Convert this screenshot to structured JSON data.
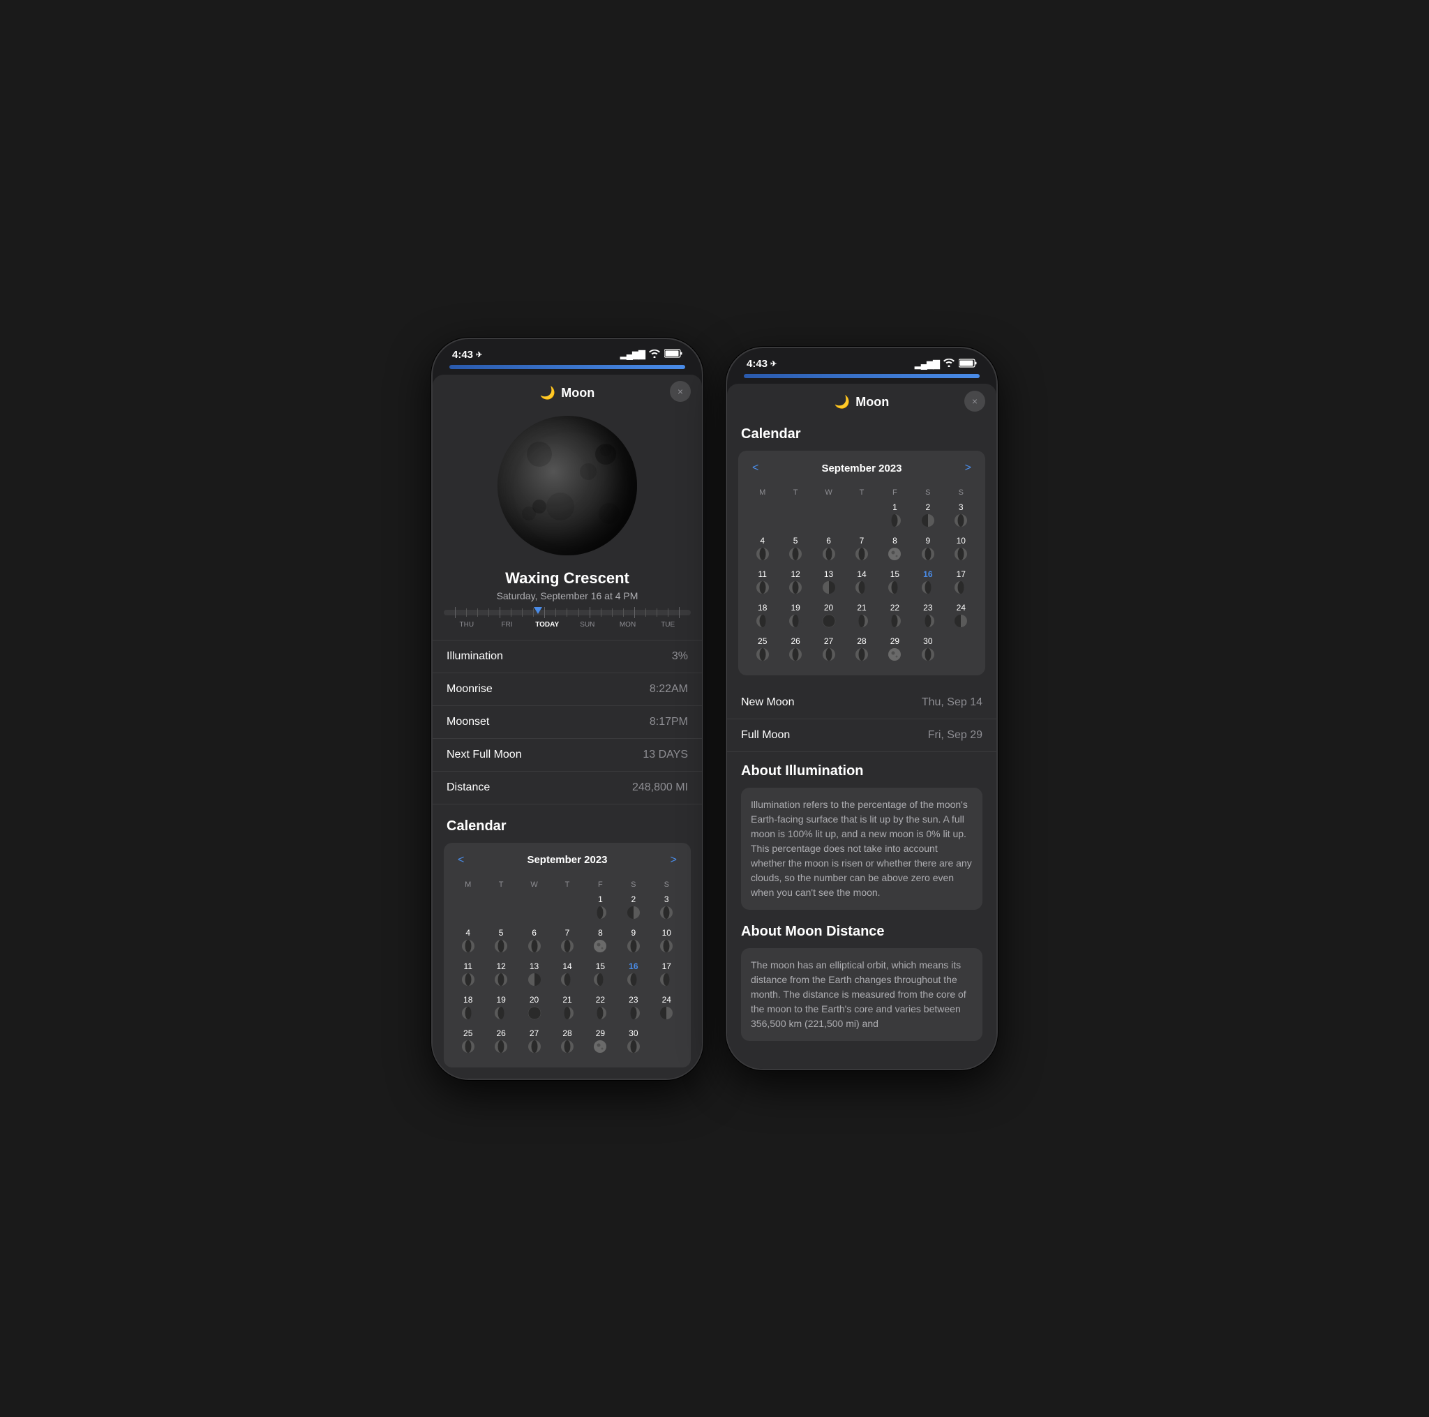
{
  "phone_left": {
    "status": {
      "time": "4:43",
      "location_icon": "▶",
      "signal_bars": "▐▌▌▌",
      "wifi": "wifi",
      "battery": "battery"
    },
    "app_title": "Moon",
    "close_label": "×",
    "moon_phase": "Waxing Crescent",
    "moon_date": "Saturday, September 16 at 4 PM",
    "timeline": {
      "labels": [
        "THU",
        "FRI",
        "TODAY",
        "SUN",
        "MON",
        "TUE"
      ]
    },
    "stats": [
      {
        "label": "Illumination",
        "value": "3%"
      },
      {
        "label": "Moonrise",
        "value": "8:22AM"
      },
      {
        "label": "Moonset",
        "value": "8:17PM"
      },
      {
        "label": "Next Full Moon",
        "value": "13 DAYS"
      },
      {
        "label": "Distance",
        "value": "248,800 MI"
      }
    ],
    "calendar_title": "Calendar",
    "calendar": {
      "month": "September 2023",
      "weekdays": [
        "M",
        "T",
        "W",
        "T",
        "F",
        "S",
        "S"
      ],
      "weeks": [
        [
          {
            "date": "",
            "phase": "none"
          },
          {
            "date": "",
            "phase": "none"
          },
          {
            "date": "",
            "phase": "none"
          },
          {
            "date": "",
            "phase": "none"
          },
          {
            "date": "1",
            "phase": "waxing-crescent"
          },
          {
            "date": "2",
            "phase": "first-quarter"
          },
          {
            "date": "3",
            "phase": "waxing-gibbous"
          }
        ],
        [
          {
            "date": "4",
            "phase": "waxing-gibbous"
          },
          {
            "date": "5",
            "phase": "waxing-gibbous"
          },
          {
            "date": "6",
            "phase": "waxing-gibbous"
          },
          {
            "date": "7",
            "phase": "waxing-gibbous"
          },
          {
            "date": "8",
            "phase": "full"
          },
          {
            "date": "9",
            "phase": "waning-gibbous"
          },
          {
            "date": "10",
            "phase": "waning-gibbous"
          }
        ],
        [
          {
            "date": "11",
            "phase": "waning-gibbous"
          },
          {
            "date": "12",
            "phase": "waning-gibbous"
          },
          {
            "date": "13",
            "phase": "third-quarter"
          },
          {
            "date": "14",
            "phase": "waning-crescent"
          },
          {
            "date": "15",
            "phase": "waning-crescent"
          },
          {
            "date": "16",
            "phase": "waning-crescent",
            "today": true
          },
          {
            "date": "17",
            "phase": "waning-crescent"
          }
        ],
        [
          {
            "date": "18",
            "phase": "waning-crescent"
          },
          {
            "date": "19",
            "phase": "waning-crescent"
          },
          {
            "date": "20",
            "phase": "new"
          },
          {
            "date": "21",
            "phase": "waxing-crescent"
          },
          {
            "date": "22",
            "phase": "waxing-crescent"
          },
          {
            "date": "23",
            "phase": "waxing-crescent"
          },
          {
            "date": "24",
            "phase": "first-quarter"
          }
        ],
        [
          {
            "date": "25",
            "phase": "waxing-gibbous"
          },
          {
            "date": "26",
            "phase": "waxing-gibbous"
          },
          {
            "date": "27",
            "phase": "waxing-gibbous"
          },
          {
            "date": "28",
            "phase": "waxing-gibbous"
          },
          {
            "date": "29",
            "phase": "full"
          },
          {
            "date": "30",
            "phase": "waning-gibbous"
          },
          {
            "date": "",
            "phase": "none"
          }
        ]
      ]
    }
  },
  "phone_right": {
    "status": {
      "time": "4:43",
      "location_icon": "▶"
    },
    "app_title": "Moon",
    "close_label": "×",
    "calendar_title": "Calendar",
    "calendar": {
      "month": "September 2023",
      "weekdays": [
        "M",
        "T",
        "W",
        "T",
        "F",
        "S",
        "S"
      ],
      "weeks": [
        [
          {
            "date": "",
            "phase": "none"
          },
          {
            "date": "",
            "phase": "none"
          },
          {
            "date": "",
            "phase": "none"
          },
          {
            "date": "",
            "phase": "none"
          },
          {
            "date": "1",
            "phase": "waxing-crescent"
          },
          {
            "date": "2",
            "phase": "first-quarter"
          },
          {
            "date": "3",
            "phase": "waxing-gibbous"
          }
        ],
        [
          {
            "date": "4",
            "phase": "waxing-gibbous"
          },
          {
            "date": "5",
            "phase": "waxing-gibbous"
          },
          {
            "date": "6",
            "phase": "waxing-gibbous"
          },
          {
            "date": "7",
            "phase": "waxing-gibbous"
          },
          {
            "date": "8",
            "phase": "full"
          },
          {
            "date": "9",
            "phase": "waning-gibbous"
          },
          {
            "date": "10",
            "phase": "waning-gibbous"
          }
        ],
        [
          {
            "date": "11",
            "phase": "waning-gibbous"
          },
          {
            "date": "12",
            "phase": "waning-gibbous"
          },
          {
            "date": "13",
            "phase": "third-quarter"
          },
          {
            "date": "14",
            "phase": "waning-crescent"
          },
          {
            "date": "15",
            "phase": "waning-crescent"
          },
          {
            "date": "16",
            "phase": "waning-crescent",
            "today": true
          },
          {
            "date": "17",
            "phase": "waning-crescent"
          }
        ],
        [
          {
            "date": "18",
            "phase": "waning-crescent"
          },
          {
            "date": "19",
            "phase": "waning-crescent"
          },
          {
            "date": "20",
            "phase": "new"
          },
          {
            "date": "21",
            "phase": "waxing-crescent"
          },
          {
            "date": "22",
            "phase": "waxing-crescent"
          },
          {
            "date": "23",
            "phase": "waxing-crescent"
          },
          {
            "date": "24",
            "phase": "first-quarter"
          }
        ],
        [
          {
            "date": "25",
            "phase": "waxing-gibbous"
          },
          {
            "date": "26",
            "phase": "waxing-gibbous"
          },
          {
            "date": "27",
            "phase": "waxing-gibbous"
          },
          {
            "date": "28",
            "phase": "waxing-gibbous"
          },
          {
            "date": "29",
            "phase": "full"
          },
          {
            "date": "30",
            "phase": "waning-gibbous"
          },
          {
            "date": "",
            "phase": "none"
          }
        ]
      ]
    },
    "moon_events": [
      {
        "label": "New Moon",
        "date": "Thu, Sep 14"
      },
      {
        "label": "Full Moon",
        "date": "Fri, Sep 29"
      }
    ],
    "about_illumination": {
      "title": "About Illumination",
      "text": "Illumination refers to the percentage of the moon's Earth-facing surface that is lit up by the sun. A full moon is 100% lit up, and a new moon is 0% lit up. This percentage does not take into account whether the moon is risen or whether there are any clouds, so the number can be above zero even when you can't see the moon."
    },
    "about_distance": {
      "title": "About Moon Distance",
      "text": "The moon has an elliptical orbit, which means its distance from the Earth changes throughout the month. The distance is measured from the core of the moon to the Earth's core and varies between 356,500 km (221,500 mi) and"
    }
  }
}
